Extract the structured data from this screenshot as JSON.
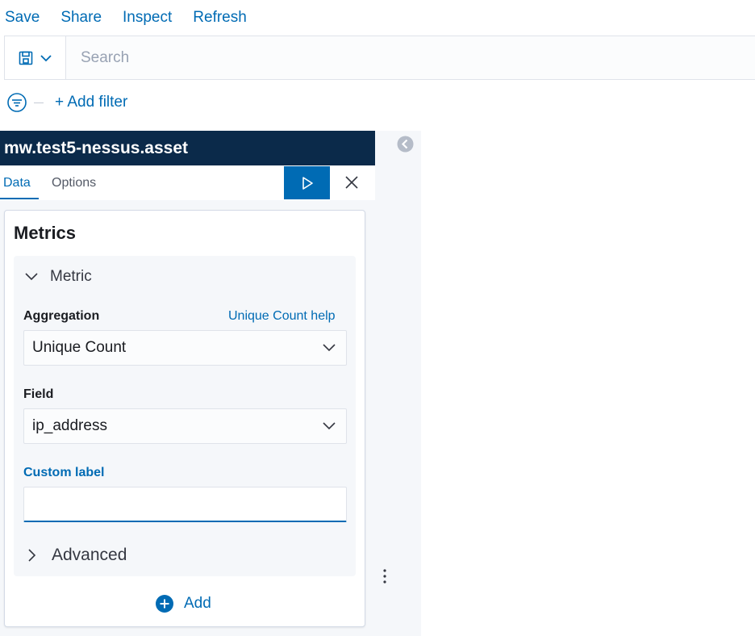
{
  "menu": {
    "save": "Save",
    "share": "Share",
    "inspect": "Inspect",
    "refresh": "Refresh"
  },
  "search": {
    "placeholder": "Search"
  },
  "filter": {
    "add_label": "+ Add filter"
  },
  "panel": {
    "index_pattern": "mw.test5-nessus.asset",
    "tabs": [
      "Data",
      "Options"
    ],
    "section_title": "Metrics",
    "metric": {
      "toggle_label": "Metric",
      "aggregation_label": "Aggregation",
      "aggregation_help": "Unique Count help",
      "aggregation_value": "Unique Count",
      "field_label": "Field",
      "field_value": "ip_address",
      "custom_label": "Custom label",
      "custom_value": "",
      "advanced_label": "Advanced"
    },
    "add_label": "Add"
  },
  "colors": {
    "accent": "#006bb4",
    "header_bg": "#0b2a4a",
    "panel_bg": "#f5f7fa"
  },
  "icons": [
    "save-icon",
    "chevron-down-icon",
    "filter-icon",
    "play-icon",
    "close-icon",
    "chevron-right-icon",
    "plus-circle-icon",
    "collapse-arrow-icon",
    "vertical-dots-icon"
  ]
}
